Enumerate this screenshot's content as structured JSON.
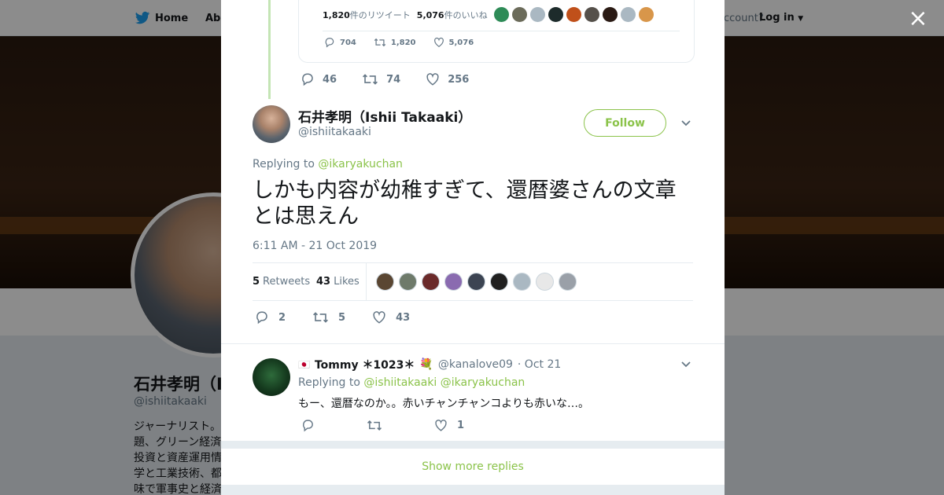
{
  "background": {
    "nav": {
      "home": "Home",
      "about": "Abo",
      "account": "ccount?",
      "login": "Log in"
    },
    "profile": {
      "name": "石井孝明（I",
      "handle": "@ishiitakaaki",
      "bio": [
        "ジャーナリスト。",
        "題、グリーン経済",
        "投資と資産運用情",
        "学と工業技術、都",
        "味で軍事史と経済"
      ]
    }
  },
  "close_label": "×",
  "quoted": {
    "retweets": "1,820",
    "retweets_label": "件のリツイート",
    "likes": "5,076",
    "likes_label": "件のいいね",
    "avatar_colors": [
      "#2e8b57",
      "#6b6b5a",
      "#aab8c2",
      "#1d2b2b",
      "#c0501a",
      "#55504a",
      "#2a1a14",
      "#aab8c2",
      "#d8964a"
    ],
    "actions": {
      "reply": "704",
      "retweet": "1,820",
      "like": "5,076"
    }
  },
  "prev_actions": {
    "reply": "46",
    "retweet": "74",
    "like": "256"
  },
  "tweet": {
    "name": "石井孝明（Ishii Takaaki）",
    "handle": "@ishiitakaaki",
    "follow": "Follow",
    "replying_prefix": "Replying to",
    "replying_to": "@ikaryakuchan",
    "text": "しかも内容が幼稚すぎて、還暦婆さんの文章とは思えん",
    "time": "6:11 AM - 21 Oct 2019",
    "retweets": "5",
    "retweets_label": "Retweets",
    "likes": "43",
    "likes_label": "Likes",
    "liker_colors": [
      "#5a4632",
      "#6e7a6a",
      "#6b2a2a",
      "#8a6bb0",
      "#3c4452",
      "#202020",
      "#aab8c2",
      "#e8e8e8",
      "#9aa0a8"
    ],
    "actions": {
      "reply": "2",
      "retweet": "5",
      "like": "43"
    }
  },
  "reply": {
    "flag": "🇯🇵",
    "name": "Tommy ＊1023＊",
    "emoji": "💐",
    "handle": "@kanalove09",
    "date": "· Oct 21",
    "replying_prefix": "Replying to",
    "replying_to_1": "@ishiitakaaki",
    "replying_to_2": "@ikaryakuchan",
    "text": "もー、還暦なのか。。赤いチャンチャンコよりも赤いな…。",
    "actions": {
      "reply": "",
      "retweet": "",
      "like": "1"
    }
  },
  "show_more": "Show more replies"
}
